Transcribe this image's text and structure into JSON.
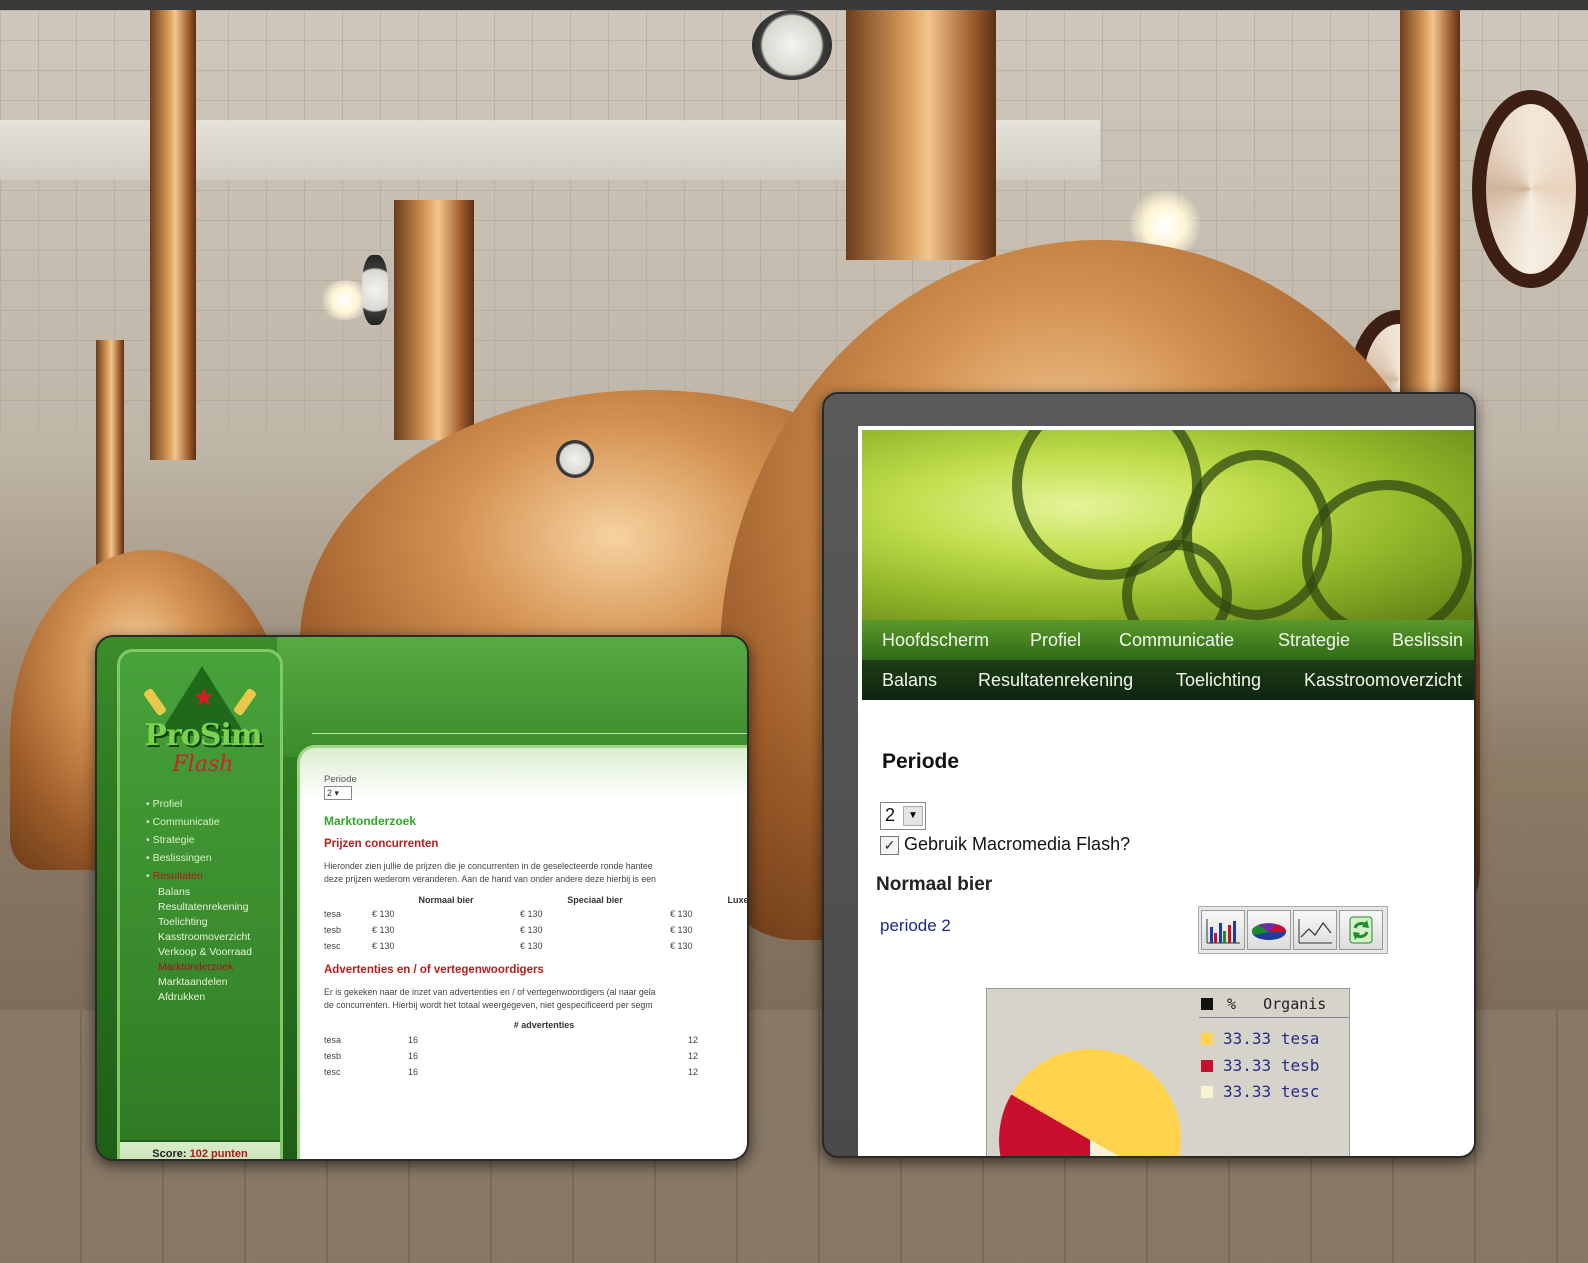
{
  "left_screenshot": {
    "logo_text": "ProSim",
    "logo_sub": "Flash",
    "nav": [
      {
        "label": "Profiel",
        "active": false
      },
      {
        "label": "Communicatie",
        "active": false
      },
      {
        "label": "Strategie",
        "active": false
      },
      {
        "label": "Beslissingen",
        "active": false
      },
      {
        "label": "Resultaten",
        "active": true
      }
    ],
    "subnav": [
      {
        "label": "Balans",
        "active": false
      },
      {
        "label": "Resultatenrekening",
        "active": false
      },
      {
        "label": "Toelichting",
        "active": false
      },
      {
        "label": "Kasstroomoverzicht",
        "active": false
      },
      {
        "label": "Verkoop & Voorraad",
        "active": false
      },
      {
        "label": "Marktonderzoek",
        "active": true
      },
      {
        "label": "Marktaandelen",
        "active": false
      },
      {
        "label": "Afdrukken",
        "active": false
      }
    ],
    "score_label": "Score:",
    "score_value": "102 punten",
    "periode_label": "Periode",
    "periode_value": "2",
    "heading": "Marktonderzoek",
    "section1_title": "Prijzen concurrenten",
    "section1_text_line1": "Hieronder zien jullie de prijzen die je concurrenten in de geselecteerde ronde hantee",
    "section1_text_line2": "deze prijzen wederom veranderen. Aan de hand van onder andere deze hierbij is een",
    "price_table": {
      "headers": [
        "",
        "Normaal bier",
        "Speciaal bier",
        "Luxe bie"
      ],
      "rows": [
        [
          "tesa",
          "€ 130",
          "€ 130",
          "€ 130"
        ],
        [
          "tesb",
          "€ 130",
          "€ 130",
          "€ 130"
        ],
        [
          "tesc",
          "€ 130",
          "€ 130",
          "€ 130"
        ]
      ]
    },
    "section2_title": "Advertenties en / of vertegenwoordigers",
    "section2_text_line1": "Er is gekeken naar de inzet van advertenties en / of vertegenwoordigers (al naar gela",
    "section2_text_line2": "de concurrenten. Hierbij wordt het totaal weergegeven, niet gespecificeerd per segm",
    "ad_table": {
      "header": "# advertenties",
      "rows": [
        [
          "tesa",
          "16",
          "12"
        ],
        [
          "tesb",
          "16",
          "12"
        ],
        [
          "tesc",
          "16",
          "12"
        ]
      ]
    }
  },
  "right_screenshot": {
    "nav_top": [
      "Hoofdscherm",
      "Profiel",
      "Communicatie",
      "Strategie",
      "Beslissin"
    ],
    "nav_bottom": [
      "Balans",
      "Resultatenrekening",
      "Toelichting",
      "Kasstroomoverzicht"
    ],
    "periode_title": "Periode",
    "periode_value": "2",
    "checkbox_label": "Gebruik Macromedia Flash?",
    "checkbox_checked": true,
    "subheading": "Normaal bier",
    "periode_link": "periode 2",
    "chart_icons": [
      "bar-chart-icon",
      "pie-chart-icon",
      "line-chart-icon",
      "refresh-icon"
    ],
    "legend_header": {
      "percent": "%",
      "org": "Organis"
    },
    "legend": [
      {
        "value": "33.33",
        "name": "tesa",
        "color": "#ffd34d"
      },
      {
        "value": "33.33",
        "name": "tesb",
        "color": "#c8102e"
      },
      {
        "value": "33.33",
        "name": "tesc",
        "color": "#f8f2d2"
      }
    ]
  }
}
